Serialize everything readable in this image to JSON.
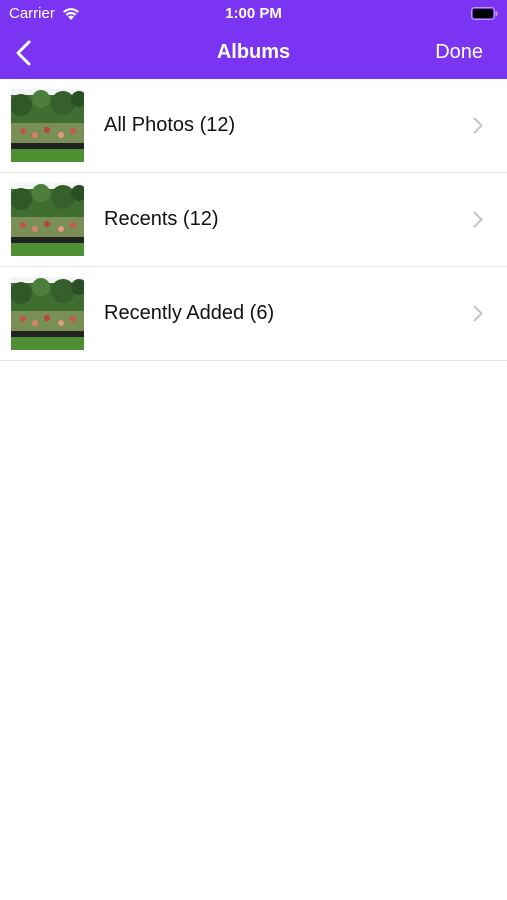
{
  "status_bar": {
    "carrier": "Carrier",
    "time": "1:00 PM"
  },
  "nav": {
    "title": "Albums",
    "done_label": "Done",
    "back_icon": "chevron-left-icon"
  },
  "albums": [
    {
      "label": "All Photos (12)"
    },
    {
      "label": "Recents (12)"
    },
    {
      "label": "Recently Added (6)"
    }
  ],
  "colors": {
    "header": "#7b35f2",
    "background": "#ffffff",
    "separator": "#e6e6e6",
    "chevron": "#c4c4c9"
  }
}
